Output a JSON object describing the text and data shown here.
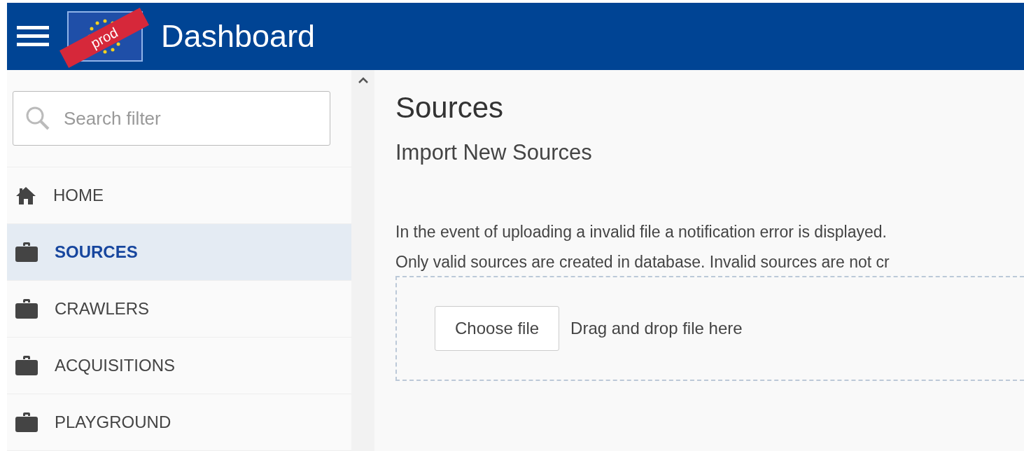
{
  "header": {
    "title": "Dashboard",
    "badge": "prod"
  },
  "sidebar": {
    "search": {
      "placeholder": "Search filter"
    },
    "items": [
      {
        "label": "HOME",
        "kind": "home",
        "selected": false
      },
      {
        "label": "SOURCES",
        "kind": "section",
        "selected": true
      },
      {
        "label": "CRAWLERS",
        "kind": "section",
        "selected": false
      },
      {
        "label": "ACQUISITIONS",
        "kind": "section",
        "selected": false
      },
      {
        "label": "PLAYGROUND",
        "kind": "section",
        "selected": false
      }
    ]
  },
  "main": {
    "title": "Sources",
    "subtitle": "Import New Sources",
    "paragraphs": [
      "In the event of uploading a invalid file a notification error is displayed.",
      "Only valid sources are created in database. Invalid sources are not cr"
    ],
    "upload": {
      "button": "Choose file",
      "hint": "Drag and drop file here"
    }
  }
}
